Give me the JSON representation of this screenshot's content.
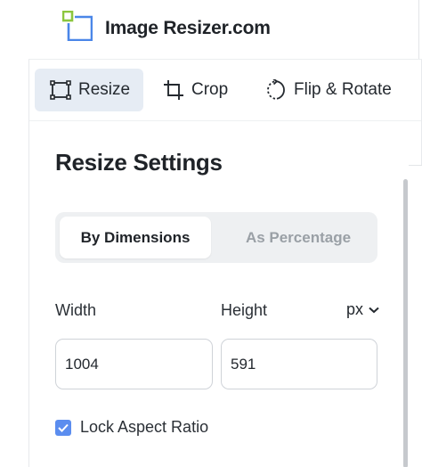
{
  "brand": {
    "name": "Image Resizer.com",
    "logo_icon": "resize-square-logo-icon",
    "colors": {
      "green": "#8cc63e",
      "blue": "#4a86e8"
    }
  },
  "tabs": [
    {
      "label": "Resize",
      "icon": "resize-frame-icon",
      "active": true
    },
    {
      "label": "Crop",
      "icon": "crop-icon",
      "active": false
    },
    {
      "label": "Flip & Rotate",
      "icon": "rotate-icon",
      "active": false
    }
  ],
  "settings": {
    "title": "Resize Settings",
    "modes": [
      {
        "label": "By Dimensions",
        "active": true
      },
      {
        "label": "As Percentage",
        "active": false
      }
    ],
    "width_label": "Width",
    "height_label": "Height",
    "unit": "px",
    "width_value": "1004",
    "height_value": "591",
    "lock_label": "Lock Aspect Ratio",
    "lock_checked": true
  },
  "colors": {
    "active_tab_bg": "#e6ecf4",
    "checkbox": "#5b8def",
    "segment_bg": "#eef0f2",
    "muted_text": "#9aa0a6"
  }
}
